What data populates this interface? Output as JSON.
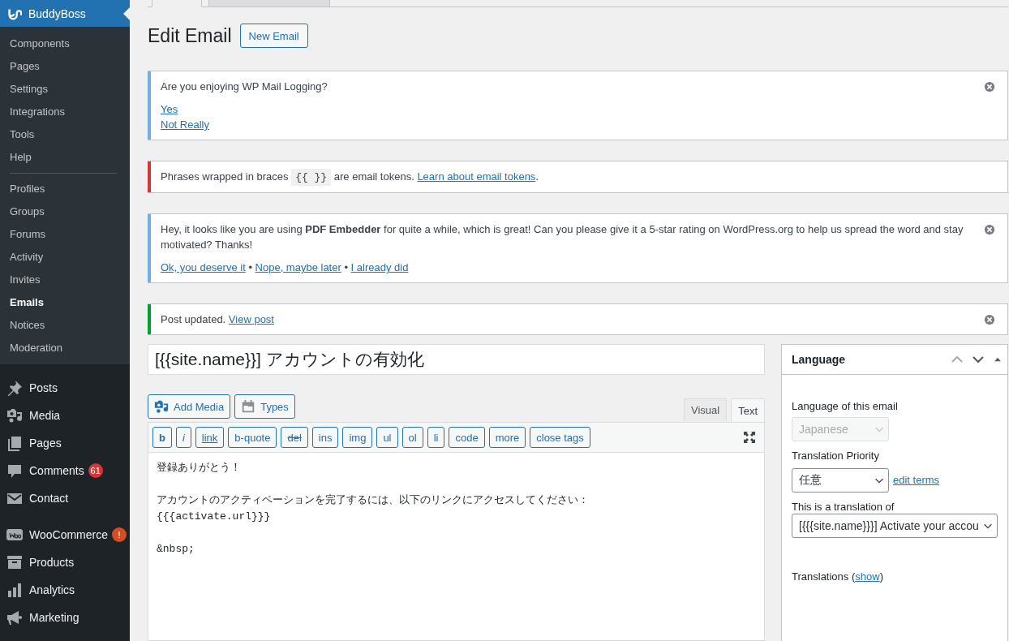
{
  "sidebar": {
    "header": {
      "label": "BuddyBoss",
      "selected": true
    },
    "submenu_groups": [
      [
        {
          "label": "Components",
          "selected": false
        },
        {
          "label": "Pages",
          "selected": false
        },
        {
          "label": "Settings",
          "selected": false
        },
        {
          "label": "Integrations",
          "selected": false
        },
        {
          "label": "Tools",
          "selected": false
        },
        {
          "label": "Help",
          "selected": false
        }
      ],
      [
        {
          "label": "Profiles",
          "selected": false
        },
        {
          "label": "Groups",
          "selected": false
        },
        {
          "label": "Forums",
          "selected": false
        },
        {
          "label": "Activity",
          "selected": false
        },
        {
          "label": "Invites",
          "selected": false
        },
        {
          "label": "Emails",
          "selected": true
        },
        {
          "label": "Notices",
          "selected": false
        },
        {
          "label": "Moderation",
          "selected": false
        }
      ]
    ],
    "menu_groups": [
      [
        {
          "label": "Posts"
        },
        {
          "label": "Media"
        },
        {
          "label": "Pages"
        },
        {
          "label": "Comments",
          "badge": "61",
          "color": "#d63638"
        },
        {
          "label": "Contact"
        }
      ],
      [
        {
          "label": "WooCommerce",
          "badge": "!",
          "color": "#d54e21"
        },
        {
          "label": "Products"
        },
        {
          "label": "Analytics"
        },
        {
          "label": "Marketing"
        }
      ]
    ]
  },
  "page": {
    "title": "Edit Email",
    "action": "New Email"
  },
  "notices": [
    {
      "color": "#72aee6",
      "dismissible": true,
      "paragraphs": [
        [
          {
            "kind": "text",
            "text": "Are you enjoying WP Mail Logging?"
          }
        ],
        [
          {
            "kind": "link",
            "text": "Yes"
          },
          {
            "kind": "break"
          },
          {
            "kind": "link",
            "text": "Not Really"
          }
        ]
      ]
    },
    {
      "color": "#d63638",
      "dismissible": false,
      "paragraphs": [
        [
          {
            "kind": "text",
            "text": "Phrases wrapped in braces "
          },
          {
            "kind": "code",
            "text": "{{ }}"
          },
          {
            "kind": "text",
            "text": " are email tokens. "
          },
          {
            "kind": "link",
            "text": "Learn about email tokens"
          },
          {
            "kind": "text",
            "text": "."
          }
        ]
      ]
    },
    {
      "color": "#72aee6",
      "dismissible": true,
      "paragraphs": [
        [
          {
            "kind": "text",
            "text": "Hey, it looks like you are using **PDF Embedder** for quite a while, which is great! Can you please give it a 5-star rating on WordPress.org to help us spread the word and stay motivated? Thanks!"
          }
        ],
        [
          {
            "kind": "link",
            "text": "Ok, you deserve it"
          },
          {
            "kind": "text",
            "text": " • "
          },
          {
            "kind": "link",
            "text": "Nope, maybe later"
          },
          {
            "kind": "text",
            "text": " • "
          },
          {
            "kind": "link",
            "text": "I already did"
          }
        ]
      ]
    },
    {
      "color": "#00a32a",
      "dismissible": true,
      "paragraphs": [
        [
          {
            "kind": "text",
            "text": "Post updated. "
          },
          {
            "kind": "link",
            "text": "View post"
          }
        ]
      ]
    }
  ],
  "editor": {
    "title": "[{{site.name}}] アカウントの有効化",
    "media_buttons": [
      "Add Media",
      "Types"
    ],
    "tabs": [
      {
        "label": "Visual",
        "selected": false
      },
      {
        "label": "Text",
        "selected": true
      }
    ],
    "quicktags": [
      {
        "label": "b",
        "kind": "bold"
      },
      {
        "label": "i",
        "kind": "italic"
      },
      {
        "label": "link",
        "kind": "underline"
      },
      {
        "label": "b-quote",
        "kind": "plain"
      },
      {
        "label": "del",
        "kind": "strike"
      },
      {
        "label": "ins",
        "kind": "plain"
      },
      {
        "label": "img",
        "kind": "plain"
      },
      {
        "label": "ul",
        "kind": "plain"
      },
      {
        "label": "ol",
        "kind": "plain"
      },
      {
        "label": "li",
        "kind": "plain"
      },
      {
        "label": "code",
        "kind": "plain"
      },
      {
        "label": "more",
        "kind": "plain"
      },
      {
        "label": "close tags",
        "kind": "plain"
      }
    ],
    "content": [
      [
        "登録ありがとう！"
      ],
      [
        "アカウントのアクティベーションを完了するには、以下のリンクにアクセスしてください：",
        "{{{activate.url}}}"
      ],
      [
        "&nbsp;"
      ]
    ]
  },
  "language_box": {
    "title": "Language",
    "language_label": "Language of this email",
    "language": {
      "value": "Japanese",
      "disabled": true
    },
    "priority_label": "Translation Priority",
    "priority": {
      "value": "任意",
      "disabled": false
    },
    "edit_terms": "edit terms",
    "translation_of_label": "This is a translation of",
    "translation_of": {
      "value": "[{{{site.name}}}] Activate your accou",
      "disabled": false
    },
    "translations_label": "Translations (",
    "translations_link": "show",
    "translations_close": ")"
  }
}
